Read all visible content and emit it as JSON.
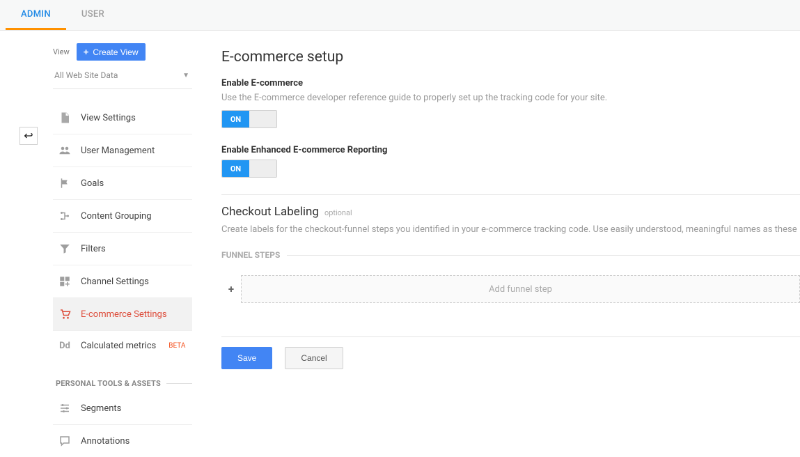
{
  "tabs": {
    "admin": "ADMIN",
    "user": "USER"
  },
  "view": {
    "label": "View",
    "create_button": "Create View",
    "selected": "All Web Site Data"
  },
  "nav": {
    "items": [
      {
        "label": "View Settings"
      },
      {
        "label": "User Management"
      },
      {
        "label": "Goals"
      },
      {
        "label": "Content Grouping"
      },
      {
        "label": "Filters"
      },
      {
        "label": "Channel Settings"
      },
      {
        "label": "E-commerce Settings",
        "active": true
      },
      {
        "label": "Calculated metrics",
        "badge": "BETA"
      }
    ],
    "section2_title": "PERSONAL TOOLS & ASSETS",
    "section2_items": [
      {
        "label": "Segments"
      },
      {
        "label": "Annotations"
      }
    ]
  },
  "page": {
    "title": "E-commerce setup",
    "enable_ecom_label": "Enable E-commerce",
    "enable_ecom_help": "Use the E-commerce developer reference guide to properly set up the tracking code for your site.",
    "toggle_on": "ON",
    "enable_enhanced_label": "Enable Enhanced E-commerce Reporting",
    "checkout_title": "Checkout Labeling",
    "optional": "optional",
    "checkout_desc": "Create labels for the checkout-funnel steps you identified in your e-commerce tracking code. Use easily understood, meaningful names as these",
    "funnel_steps_label": "FUNNEL STEPS",
    "add_step": "Add funnel step",
    "save": "Save",
    "cancel": "Cancel"
  }
}
